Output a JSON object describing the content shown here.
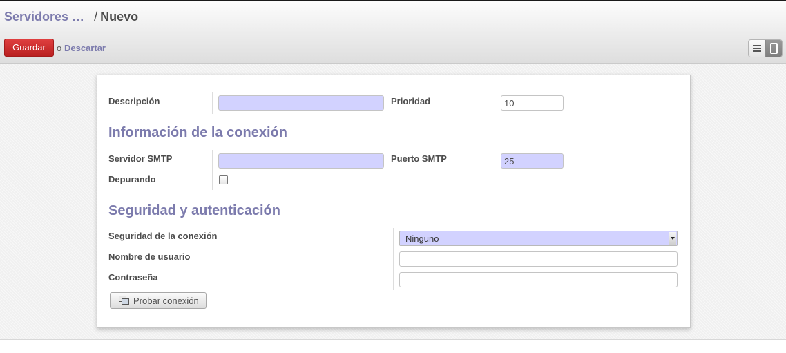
{
  "breadcrumb": {
    "parent": "Servidores …",
    "separator": "/",
    "current": "Nuevo"
  },
  "toolbar": {
    "save_label": "Guardar",
    "or_text": "o",
    "discard_label": "Descartar"
  },
  "view_switcher": {
    "options": [
      "list-view",
      "form-view"
    ],
    "active": "form-view"
  },
  "form": {
    "description": {
      "label": "Descripción",
      "value": ""
    },
    "priority": {
      "label": "Prioridad",
      "value": "10"
    },
    "connection_section": "Información de la conexión",
    "smtp_server": {
      "label": "Servidor SMTP",
      "value": ""
    },
    "smtp_port": {
      "label": "Puerto SMTP",
      "value": "25"
    },
    "debugging": {
      "label": "Depurando",
      "checked": false
    },
    "security_section": "Seguridad y autenticación",
    "connection_security": {
      "label": "Seguridad de la conexión",
      "value": "Ninguno"
    },
    "username": {
      "label": "Nombre de usuario",
      "value": ""
    },
    "password": {
      "label": "Contraseña",
      "value": ""
    },
    "test_button": "Probar conexión"
  },
  "colors": {
    "accent": "#7c7bad",
    "required_field": "#d2d2ff",
    "primary_button": "#c52828"
  }
}
